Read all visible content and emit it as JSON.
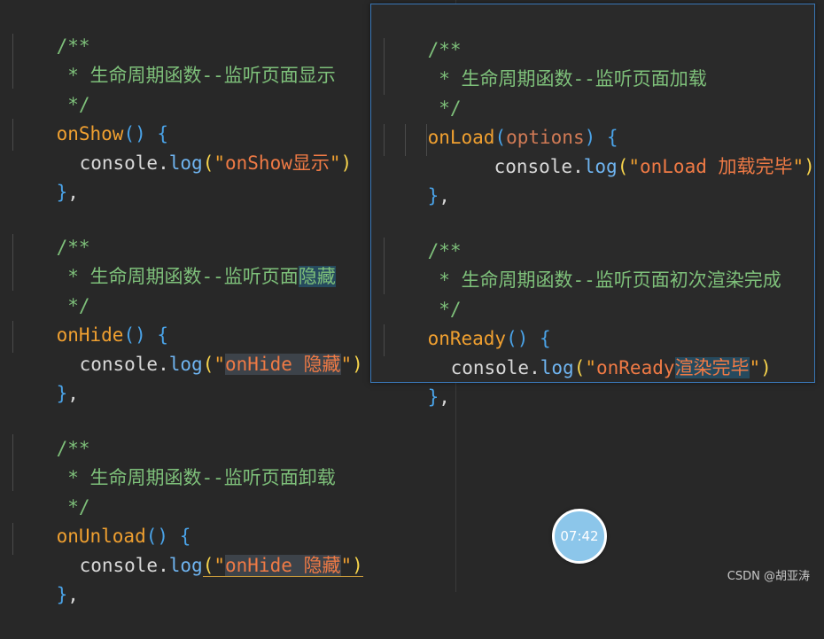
{
  "left": {
    "block1": {
      "doc_open": "/**",
      "doc_text": " * 生命周期函数--监听页面显示",
      "doc_close": " */",
      "fn_name": "onShow",
      "fn_parens": "()",
      "open_brace": "{",
      "call_obj": "console",
      "call_dot": ".",
      "call_fn": "log",
      "call_open": "(",
      "str_quote_open": "\"",
      "str_text": "onShow显示",
      "str_quote_close": "\"",
      "call_close": ")",
      "close_brace": "}",
      "comma": ","
    },
    "block2": {
      "doc_open": "/**",
      "doc_text": " * 生命周期函数--监听页面",
      "doc_text_hl": "隐藏",
      "doc_close": " */",
      "fn_name": "onHide",
      "fn_parens": "()",
      "open_brace": "{",
      "call_obj": "console",
      "call_dot": ".",
      "call_fn": "log",
      "call_open": "(",
      "str_quote_open": "\"",
      "str_text": "onHide 隐藏",
      "str_quote_close": "\"",
      "call_close": ")",
      "close_brace": "}",
      "comma": ","
    },
    "block3": {
      "doc_open": "/**",
      "doc_text": " * 生命周期函数--监听页面卸载",
      "doc_close": " */",
      "fn_name": "onUnload",
      "fn_parens": "()",
      "open_brace": "{",
      "call_obj": "console",
      "call_dot": ".",
      "call_fn": "log",
      "call_open": "(",
      "str_quote_open": "\"",
      "str_text": "onHide 隐藏",
      "str_quote_close": "\"",
      "call_close": ")",
      "close_brace": "}",
      "comma": ","
    }
  },
  "popup": {
    "block1": {
      "doc_open": "/**",
      "doc_text": " * 生命周期函数--监听页面加载",
      "doc_close": " */",
      "fn_name": "onLoad",
      "paren_open": "(",
      "param": "options",
      "paren_close": ")",
      "open_brace": "{",
      "call_obj": "console",
      "call_dot": ".",
      "call_fn": "log",
      "call_open": "(",
      "str_quote_open": "\"",
      "str_text": "onLoad 加载完毕",
      "str_quote_close": "\"",
      "call_close": ")",
      "close_brace": "}",
      "comma": ","
    },
    "block2": {
      "doc_open": "/**",
      "doc_text": " * 生命周期函数--监听页面初次渲染完成",
      "doc_close": " */",
      "fn_name": "onReady",
      "fn_parens": "()",
      "open_brace": "{",
      "call_obj": "console",
      "call_dot": ".",
      "call_fn": "log",
      "call_open": "(",
      "str_quote_open": "\"",
      "str_text": "onReady",
      "str_text_hl": "渲染完毕",
      "str_quote_close": "\"",
      "call_close": ")",
      "close_brace": "}",
      "comma": ","
    }
  },
  "timer": {
    "label": "07:42"
  },
  "watermark": {
    "text": "CSDN @胡亚涛"
  },
  "colors": {
    "background": "#282828",
    "comment": "#7ec07a",
    "function_name": "#f0a030",
    "string": "#ef7a45",
    "property": "#6fb4f0",
    "brace": "#f7d44c",
    "popup_border": "#3a78b8",
    "timer_fill": "#8cc6ea"
  }
}
